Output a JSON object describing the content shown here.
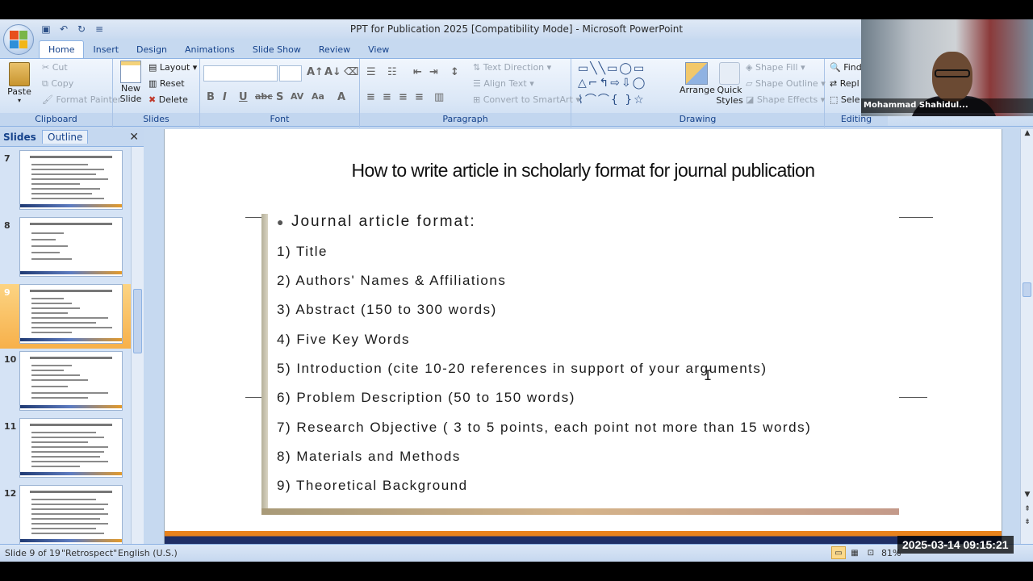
{
  "window": {
    "title": "PPT for Publication 2025 [Compatibility Mode] - Microsoft PowerPoint"
  },
  "ribbon": {
    "tabs": [
      "Home",
      "Insert",
      "Design",
      "Animations",
      "Slide Show",
      "Review",
      "View"
    ],
    "active_tab": "Home",
    "clipboard": {
      "paste": "Paste",
      "cut": "Cut",
      "copy": "Copy",
      "format_painter": "Format Painter",
      "label": "Clipboard"
    },
    "slides": {
      "new_slide": "New Slide",
      "new_slide_arrow": "▾",
      "layout": "Layout",
      "reset": "Reset",
      "delete": "Delete",
      "label": "Slides"
    },
    "font": {
      "label": "Font"
    },
    "paragraph": {
      "text_direction": "Text Direction",
      "align_text": "Align Text",
      "convert": "Convert to SmartArt",
      "label": "Paragraph"
    },
    "drawing": {
      "arrange": "Arrange",
      "quick_styles": "Quick Styles",
      "shape_fill": "Shape Fill",
      "shape_outline": "Shape Outline",
      "shape_effects": "Shape Effects",
      "label": "Drawing"
    },
    "editing": {
      "find": "Find",
      "replace": "Repl",
      "select": "Sele",
      "label": "Editing"
    }
  },
  "webcam": {
    "name": "Mohammad Shahidul..."
  },
  "left_pane": {
    "tab_slides": "Slides",
    "tab_outline": "Outline",
    "close": "✕",
    "thumbnails": [
      {
        "number": "7"
      },
      {
        "number": "8"
      },
      {
        "number": "9",
        "selected": true
      },
      {
        "number": "10"
      },
      {
        "number": "11"
      },
      {
        "number": "12"
      }
    ]
  },
  "slide": {
    "title": "How to write article in scholarly format for journal publication",
    "heading": "Journal article format:",
    "items": [
      "1) Title",
      "2) Authors' Names & Affiliations",
      "3) Abstract (150 to 300 words)",
      "4) Five Key Words",
      "5) Introduction (cite 10-20 references in support of your arguments)",
      "6) Problem Description (50 to 150 words)",
      "7) Research Objective ( 3 to 5 points, each point not more than 15 words)",
      "8) Materials and Methods",
      "9) Theoretical Background"
    ]
  },
  "statusbar": {
    "slide_info": "Slide 9 of 19",
    "theme": "\"Retrospect\"",
    "language": "English (U.S.)",
    "zoom": "81%"
  },
  "overlay": {
    "timestamp": "2025-03-14  09:15:21"
  },
  "colors": {
    "accent_orange": "#e8821c",
    "accent_navy": "#1f2f66",
    "ribbon_blue": "#15428b",
    "selection": "#f7b04a"
  }
}
